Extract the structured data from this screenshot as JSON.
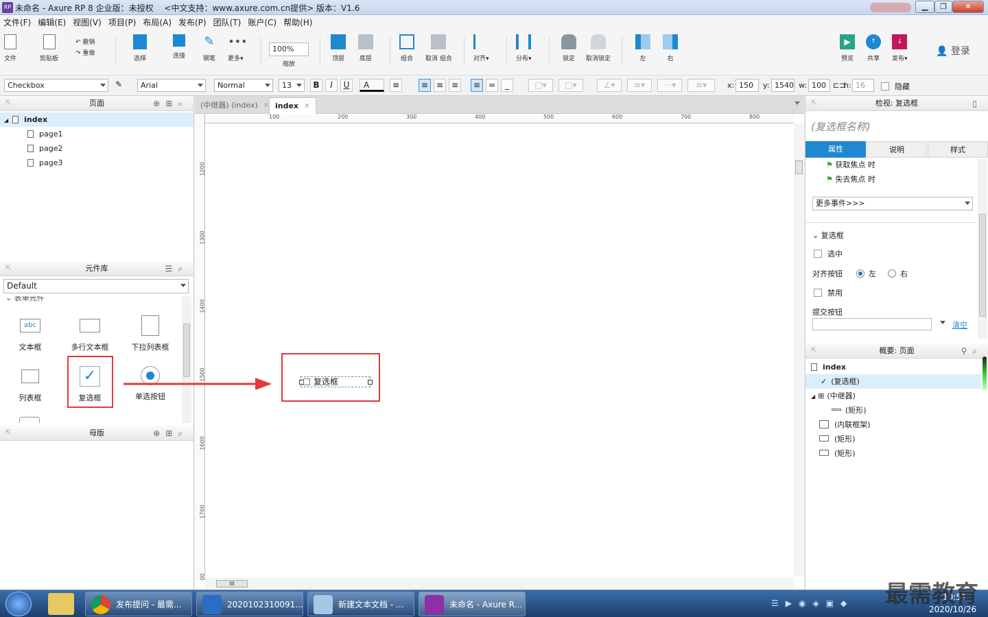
{
  "window": {
    "title": "未命名 - Axure RP 8 企业版：未授权　 <中文支持：www.axure.com.cn提供> 版本：V1.6",
    "logo": "RP"
  },
  "menu": [
    "文件(F)",
    "编辑(E)",
    "视图(V)",
    "项目(P)",
    "布局(A)",
    "发布(P)",
    "团队(T)",
    "账户(C)",
    "帮助(H)"
  ],
  "toolbar": {
    "file": "文件",
    "clipboard": "剪贴板",
    "undo": "撤销",
    "redo": "重做",
    "select": "选择",
    "connect": "连接",
    "pen": "钢笔",
    "more": "更多▾",
    "zoom_value": "100%",
    "zoom_label": "缩放",
    "top": "顶层",
    "bottom": "底层",
    "group": "组合",
    "ungroup": "取消 组合",
    "align": "对齐▾",
    "distribute": "分布▾",
    "lock": "锁定",
    "unlock": "取消锁定",
    "left": "左",
    "right": "右",
    "preview": "预览",
    "share": "共享",
    "publish": "发布▾",
    "login": "登录"
  },
  "format": {
    "widget_type": "Checkbox",
    "font": "Arial",
    "style": "Normal",
    "size": "13",
    "bold": "B",
    "italic": "I",
    "underline": "U",
    "fontcolor": "A",
    "x_label": "x:",
    "x": "150",
    "y_label": "y:",
    "y": "1540",
    "w_label": "w:",
    "w": "100",
    "h_label": "h:",
    "h": "16",
    "hide": "隐藏"
  },
  "pages_panel": {
    "title": "页面",
    "items": [
      "index",
      "page1",
      "page2",
      "page3"
    ]
  },
  "library_panel": {
    "title": "元件库",
    "selected": "Default",
    "section": "表单元件",
    "widgets": [
      "文本框",
      "多行文本框",
      "下拉列表框",
      "列表框",
      "复选框",
      "单选按钮"
    ],
    "text_icon": "abc"
  },
  "masters_panel": {
    "title": "母版"
  },
  "canvas": {
    "tabs": [
      "(中继器) (index)",
      "index"
    ],
    "hruler": [
      "100",
      "200",
      "300",
      "400",
      "500",
      "600",
      "700",
      "800"
    ],
    "vruler": [
      "1200",
      "1300",
      "1400",
      "1500",
      "1600",
      "1700",
      "1800"
    ],
    "checkbox_text": "复选框"
  },
  "inspector": {
    "title": "检视: 复选框",
    "name_placeholder": "(复选框名称)",
    "tabs": [
      "属性",
      "说明",
      "样式"
    ],
    "events": [
      "获取焦点 时",
      "失去焦点 时"
    ],
    "more_events": "更多事件>>>",
    "section": "复选框",
    "checked": "选中",
    "align_label": "对齐按钮",
    "align_left": "左",
    "align_right": "右",
    "disabled": "禁用",
    "submit_label": "提交按钮",
    "clear": "清空"
  },
  "outline": {
    "title": "概要: 页面",
    "items": [
      "index",
      "(复选框)",
      "(中继器)",
      "(矩形)",
      "(内联框架)",
      "(矩形)",
      "(矩形)"
    ]
  },
  "taskbar": {
    "items": [
      "发布提问 - 最需...",
      "2020102310091...",
      "新建文本文档 - ...",
      "未命名 - Axure R..."
    ],
    "date": "2020/10/26",
    "time": "10:51",
    "watermark": "最需教育"
  },
  "colors": {
    "accent": "#1e88d0",
    "annotation": "#e53935",
    "selection": "#dbeefc"
  }
}
